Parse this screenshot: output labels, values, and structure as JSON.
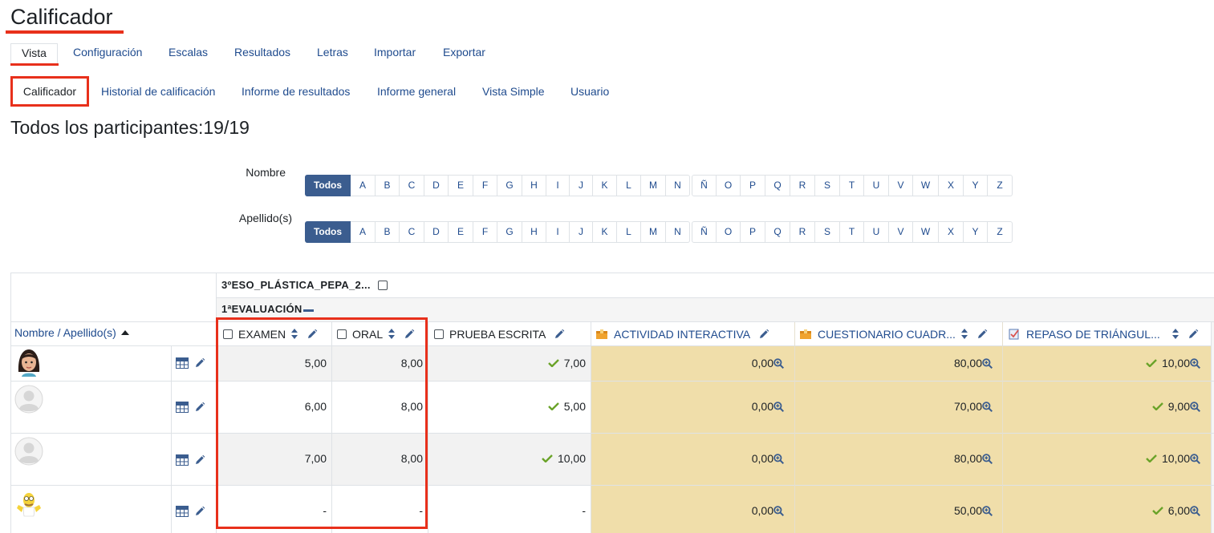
{
  "page_title": "Calificador",
  "tabs_main": [
    "Vista",
    "Configuración",
    "Escalas",
    "Resultados",
    "Letras",
    "Importar",
    "Exportar"
  ],
  "tabs_sub": [
    "Calificador",
    "Historial de calificación",
    "Informe de resultados",
    "Informe general",
    "Vista Simple",
    "Usuario"
  ],
  "participants_label": "Todos los participantes:19/19",
  "filter": {
    "first_name_label": "Nombre",
    "last_name_label": "Apellido(s)",
    "all_label": "Todos",
    "letters": [
      "A",
      "B",
      "C",
      "D",
      "E",
      "F",
      "G",
      "H",
      "I",
      "J",
      "K",
      "L",
      "M",
      "N",
      "Ñ",
      "O",
      "P",
      "Q",
      "R",
      "S",
      "T",
      "U",
      "V",
      "W",
      "X",
      "Y",
      "Z"
    ]
  },
  "grader": {
    "course_category": "3ºESO_PLÁSTICA_PEPA_2...",
    "eval_category": "1ªEVALUACIÓN",
    "name_column_header": "Nombre / Apellido(s)",
    "columns": [
      "EXAMEN",
      "ORAL",
      "PRUEBA ESCRITA",
      "ACTIVIDAD INTERACTIVA",
      "CUESTIONARIO CUADR...",
      "REPASO DE TRIÁNGUL..."
    ],
    "rows": [
      {
        "examen": "5,00",
        "oral": "8,00",
        "prueba": "7,00",
        "actividad": "0,00",
        "cuestionario": "80,00",
        "repaso": "10,00"
      },
      {
        "examen": "6,00",
        "oral": "8,00",
        "prueba": "5,00",
        "actividad": "0,00",
        "cuestionario": "70,00",
        "repaso": "9,00"
      },
      {
        "examen": "7,00",
        "oral": "8,00",
        "prueba": "10,00",
        "actividad": "0,00",
        "cuestionario": "80,00",
        "repaso": "10,00"
      },
      {
        "examen": "-",
        "oral": "-",
        "prueba": "-",
        "actividad": "0,00",
        "cuestionario": "50,00",
        "repaso": "6,00"
      }
    ]
  },
  "colors": {
    "accent_red": "#e8301b",
    "link_blue": "#1f4b8e",
    "button_blue": "#3b5d8f",
    "activity_bg": "#f0deaa",
    "check_green": "#6aa329"
  }
}
